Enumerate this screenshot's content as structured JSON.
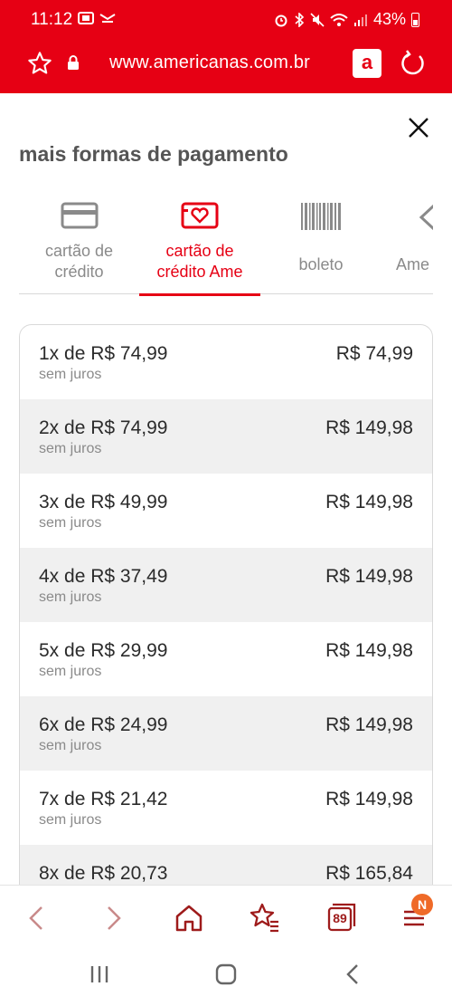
{
  "status_bar": {
    "time": "11:12",
    "battery": "43%"
  },
  "browser": {
    "url": "www.americanas.com.br",
    "site_badge": "a"
  },
  "modal": {
    "title": "mais formas de pagamento"
  },
  "tabs": [
    {
      "label_line1": "cartão de",
      "label_line2": "crédito",
      "icon": "credit-card-icon",
      "active": false
    },
    {
      "label_line1": "cartão de",
      "label_line2": "crédito Ame",
      "icon": "ame-card-icon",
      "active": true
    },
    {
      "label_line1": "boleto",
      "label_line2": "",
      "icon": "barcode-icon",
      "active": false
    },
    {
      "label_line1": "Ame",
      "label_line2": "",
      "icon": "ame-icon",
      "active": false
    }
  ],
  "installments": [
    {
      "label": "1x de R$ 74,99",
      "note": "sem juros",
      "total": "R$ 74,99"
    },
    {
      "label": "2x de R$ 74,99",
      "note": "sem juros",
      "total": "R$ 149,98"
    },
    {
      "label": "3x de R$ 49,99",
      "note": "sem juros",
      "total": "R$ 149,98"
    },
    {
      "label": "4x de R$ 37,49",
      "note": "sem juros",
      "total": "R$ 149,98"
    },
    {
      "label": "5x de R$ 29,99",
      "note": "sem juros",
      "total": "R$ 149,98"
    },
    {
      "label": "6x de R$ 24,99",
      "note": "sem juros",
      "total": "R$ 149,98"
    },
    {
      "label": "7x de R$ 21,42",
      "note": "sem juros",
      "total": "R$ 149,98"
    },
    {
      "label": "8x de R$ 20,73",
      "note": "",
      "total": "R$ 165,84"
    }
  ],
  "bottom_nav": {
    "tabs_count": "89",
    "menu_badge": "N"
  },
  "colors": {
    "brand_red": "#e60014",
    "dark_red": "#9e1b1b",
    "badge_orange": "#ef6a28"
  }
}
